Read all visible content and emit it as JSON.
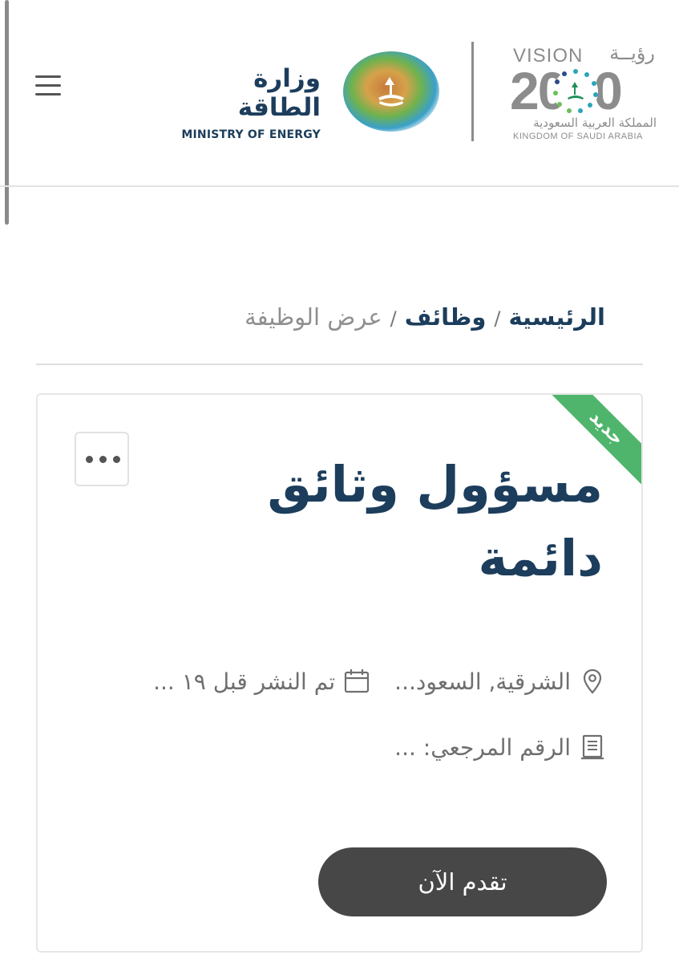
{
  "header": {
    "ministry_name_ar": "وزارة الطاقة",
    "ministry_name_en": "MINISTRY OF ENERGY",
    "vision": {
      "word_en": "VISION",
      "word_ar": "رؤيــة",
      "year": "2030",
      "kingdom_ar": "المملكة العربية السعودية",
      "kingdom_en": "KINGDOM OF SAUDI ARABIA"
    },
    "menu_icon": "hamburger-menu-icon"
  },
  "breadcrumb": {
    "home": "الرئيسية",
    "jobs": "وظائف",
    "current": "عرض الوظيفة",
    "separator": "/"
  },
  "job": {
    "badge": "جديد",
    "title": "مسؤول وثائق دائمة",
    "location": "الشرقية, السعود...",
    "posted": "تم النشر قبل ١٩ ...",
    "reference": "الرقم المرجعي: ...",
    "apply_label": "تقدم الآن",
    "icons": {
      "location": "map-pin-icon",
      "posted": "calendar-icon",
      "reference": "document-icon",
      "more": "more-options-icon"
    }
  },
  "colors": {
    "primary": "#1c3d5c",
    "badge": "#4fb56c",
    "button": "#474747",
    "muted": "#8f8f8f"
  }
}
